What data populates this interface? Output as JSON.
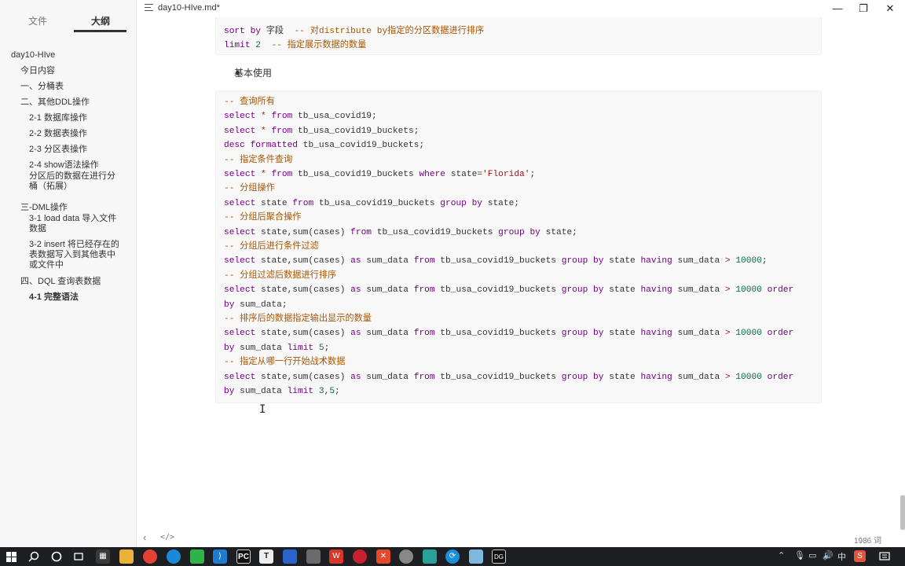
{
  "app": {
    "doc_title": "day10-HIve.md*",
    "window_controls": {
      "minimize": "—",
      "maximize": "❐",
      "close": "✕"
    }
  },
  "sidebar": {
    "tabs": [
      {
        "label": "文件"
      },
      {
        "label": "大纲"
      }
    ],
    "active_tab": "大纲",
    "outline": [
      {
        "label": "day10-HIve",
        "level": 0
      },
      {
        "label": "今日内容",
        "level": 1
      },
      {
        "label": "一、分桶表",
        "level": 1
      },
      {
        "label": "二、其他DDL操作",
        "level": 1
      },
      {
        "label": "2-1 数据库操作",
        "level": 2
      },
      {
        "label": "2-2 数据表操作",
        "level": 2
      },
      {
        "label": "2-3 分区表操作",
        "level": 2
      },
      {
        "label": "2-4 show语法操作",
        "level": 2
      },
      {
        "label": "分区后的数据在进行分\n桶（拓展）",
        "level": 2
      },
      {
        "label": "三-DML操作",
        "level": 1
      },
      {
        "label": "3-1 load data 导入文件\n数据",
        "level": 2
      },
      {
        "label": "3-2 insert 将已经存在的\n表数据写入到其他表中\n或文件中",
        "level": 2
      },
      {
        "label": "四、DQL 查询表数据",
        "level": 1
      },
      {
        "label": "4-1 完整语法",
        "level": 2,
        "active": true
      }
    ]
  },
  "editor": {
    "code_top_lines": [
      "sort by 字段  -- 对distribute by指定的分区数据进行排序",
      "limit 2  -- 指定展示数据的数量"
    ],
    "bullet": "基本使用",
    "code_lines": [
      "-- 查询所有",
      "select * from tb_usa_covid19;",
      "select * from tb_usa_covid19_buckets;",
      "desc formatted tb_usa_covid19_buckets;",
      "-- 指定条件查询",
      "select * from tb_usa_covid19_buckets where state='Florida';",
      "-- 分组操作",
      "select state from tb_usa_covid19_buckets group by state;",
      "-- 分组后聚合操作",
      "select state,sum(cases) from tb_usa_covid19_buckets group by state;",
      "-- 分组后进行条件过滤",
      "select state,sum(cases) as sum_data from tb_usa_covid19_buckets group by state having sum_data > 10000;",
      "-- 分组过滤后数据进行排序",
      "select state,sum(cases) as sum_data from tb_usa_covid19_buckets group by state having sum_data > 10000 order",
      "by sum_data;",
      "-- 排序后的数据指定输出显示的数量",
      "select state,sum(cases) as sum_data from tb_usa_covid19_buckets group by state having sum_data > 10000 order",
      "by sum_data limit 5;",
      "-- 指定从哪一行开始战术数据",
      "select state,sum(cases) as sum_data from tb_usa_covid19_buckets group by state having sum_data > 10000 order",
      "by sum_data limit 3,5;"
    ]
  },
  "statusbar": {
    "word_count": "1986 词"
  },
  "taskbar": {
    "ime": "中",
    "colors": {
      "bg": "#1e1f22"
    }
  }
}
